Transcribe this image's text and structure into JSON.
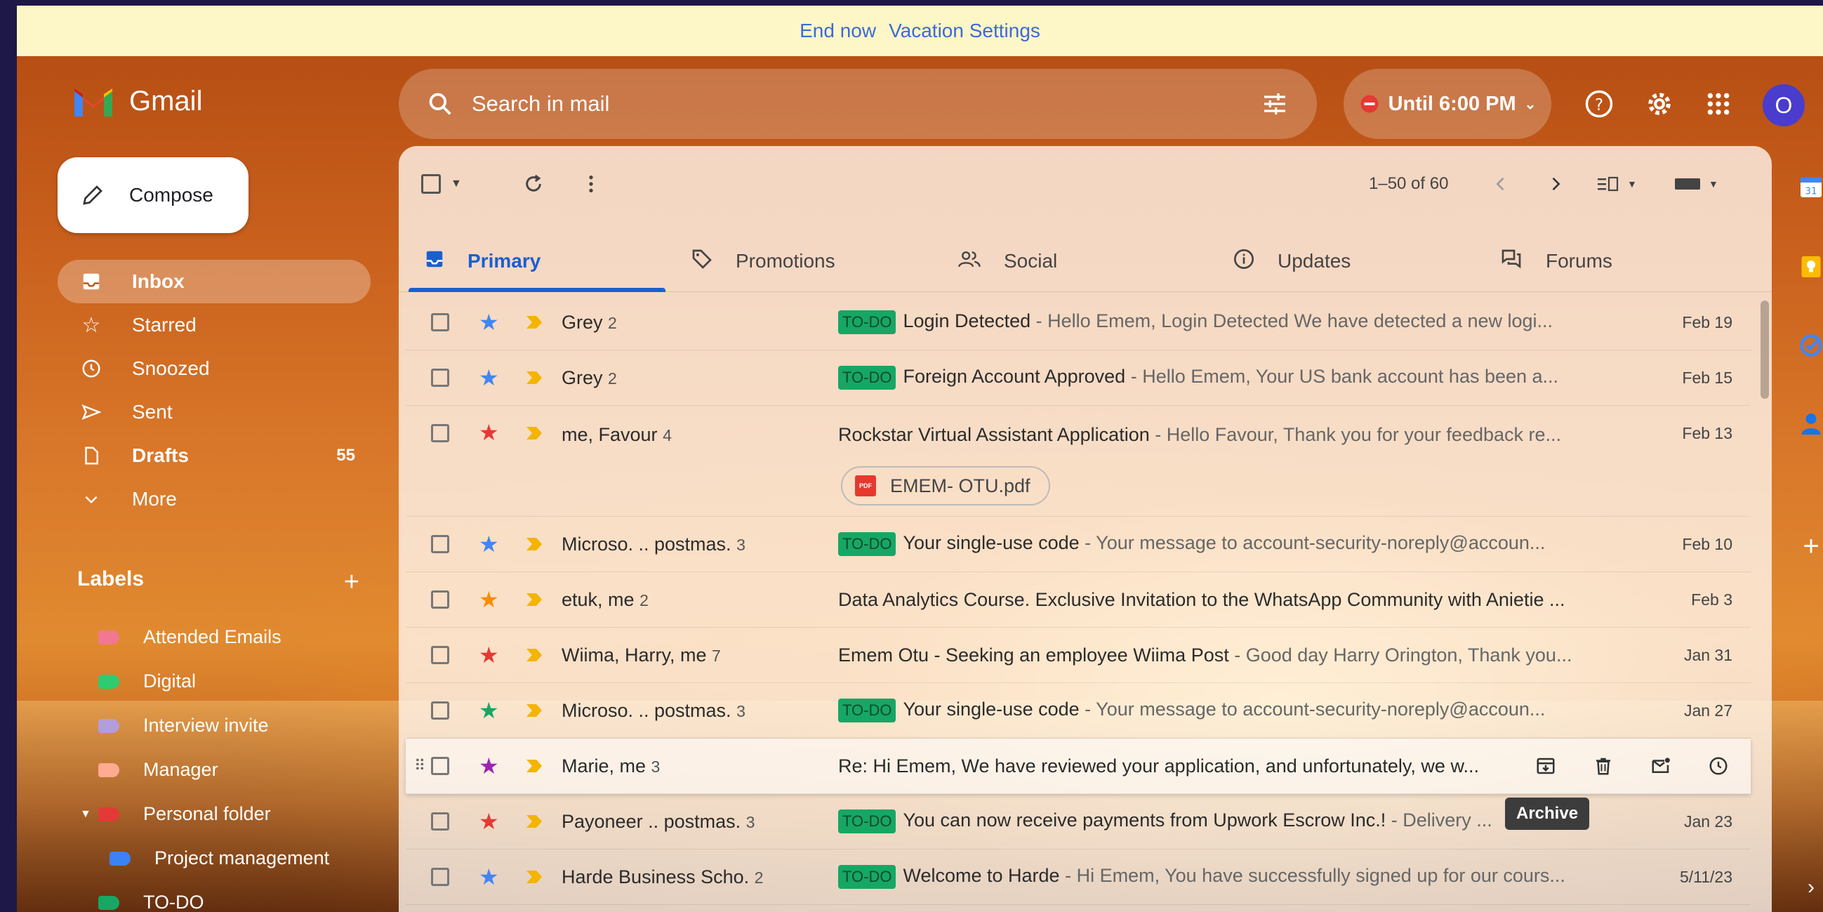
{
  "banner": {
    "end_now": "End now",
    "vacation_settings": "Vacation Settings"
  },
  "app": {
    "name": "Gmail"
  },
  "search": {
    "placeholder": "Search in mail"
  },
  "status": {
    "label": "Until 6:00 PM"
  },
  "account": {
    "initial": "O"
  },
  "compose": {
    "label": "Compose"
  },
  "nav": [
    {
      "label": "Inbox",
      "icon": "inbox-icon",
      "active": true
    },
    {
      "label": "Starred",
      "icon": "star-icon"
    },
    {
      "label": "Snoozed",
      "icon": "clock-icon"
    },
    {
      "label": "Sent",
      "icon": "send-icon"
    },
    {
      "label": "Drafts",
      "icon": "draft-icon",
      "count": "55"
    },
    {
      "label": "More",
      "icon": "chevron-down-icon"
    }
  ],
  "labels": {
    "title": "Labels",
    "items": [
      {
        "label": "Attended Emails",
        "color": "#f07890"
      },
      {
        "label": "Digital",
        "color": "#2ecc71"
      },
      {
        "label": "Interview invite",
        "color": "#b39ddb"
      },
      {
        "label": "Manager",
        "color": "#ffab91"
      },
      {
        "label": "Personal folder",
        "color": "#e53935"
      },
      {
        "label": "Project management",
        "color": "#3b82f6"
      },
      {
        "label": "TO-DO",
        "color": "#16a765"
      }
    ]
  },
  "toolbar": {
    "pagination": "1–50 of 60"
  },
  "tabs": [
    {
      "label": "Primary",
      "icon": "inbox-icon"
    },
    {
      "label": "Promotions",
      "icon": "tag-icon"
    },
    {
      "label": "Social",
      "icon": "people-icon"
    },
    {
      "label": "Updates",
      "icon": "info-icon"
    },
    {
      "label": "Forums",
      "icon": "forum-icon"
    }
  ],
  "emails": [
    {
      "sender": "Grey",
      "count": "2",
      "star": "#4285f4",
      "todo": "TO-DO",
      "subject": "Login Detected",
      "snippet": " - Hello Emem, Login Detected We have detected a new logi...",
      "date": "Feb 19"
    },
    {
      "sender": "Grey",
      "count": "2",
      "star": "#4285f4",
      "todo": "TO-DO",
      "subject": "Foreign Account Approved",
      "snippet": " - Hello Emem, Your US bank account has been a...",
      "date": "Feb 15"
    },
    {
      "sender": "me, Favour",
      "count": "4",
      "star": "#e53935",
      "todo": "",
      "subject": "Rockstar Virtual Assistant Application",
      "snippet": " - Hello Favour, Thank you for your feedback re...",
      "date": "Feb 13",
      "attachment": "EMEM- OTU.pdf"
    },
    {
      "sender": "Microso. .. postmas.",
      "count": "3",
      "star": "#4285f4",
      "todo": "TO-DO",
      "subject": "Your single-use code",
      "snippet": " - Your message to account-security-noreply@accoun...",
      "date": "Feb 10"
    },
    {
      "sender": "etuk, me",
      "count": "2",
      "star": "#fb8c00",
      "todo": "",
      "subject": "Data Analytics Course. Exclusive Invitation to the WhatsApp Community with Anietie ...",
      "snippet": "",
      "date": "Feb 3"
    },
    {
      "sender": "Wiima, Harry, me",
      "count": "7",
      "star": "#e53935",
      "todo": "",
      "subject": "Emem Otu - Seeking an employee Wiima Post",
      "snippet": " - Good day Harry Orington, Thank you...",
      "date": "Jan 31"
    },
    {
      "sender": "Microso. .. postmas.",
      "count": "3",
      "star": "#16a765",
      "todo": "TO-DO",
      "subject": "Your single-use code",
      "snippet": " - Your message to account-security-noreply@accoun...",
      "date": "Jan 27"
    },
    {
      "sender": "Marie, me",
      "count": "3",
      "star": "#9c27b0",
      "todo": "",
      "subject": "Re: Hi Emem, We have reviewed your application, and unfortunately, we w...",
      "snippet": "",
      "date": "",
      "hover": true
    },
    {
      "sender": "Payoneer .. postmas.",
      "count": "3",
      "star": "#e53935",
      "todo": "TO-DO",
      "subject": "You can now receive payments from Upwork Escrow Inc.!",
      "snippet": " - Delivery ...",
      "date": "Jan 23"
    },
    {
      "sender": "Harde Business Scho.",
      "count": "2",
      "star": "#4285f4",
      "todo": "TO-DO",
      "subject": "Welcome to Harde",
      "snippet": " - Hi Emem, You have successfully signed up for our cours...",
      "date": "5/11/23"
    }
  ],
  "tooltip": {
    "label": "Archive"
  }
}
